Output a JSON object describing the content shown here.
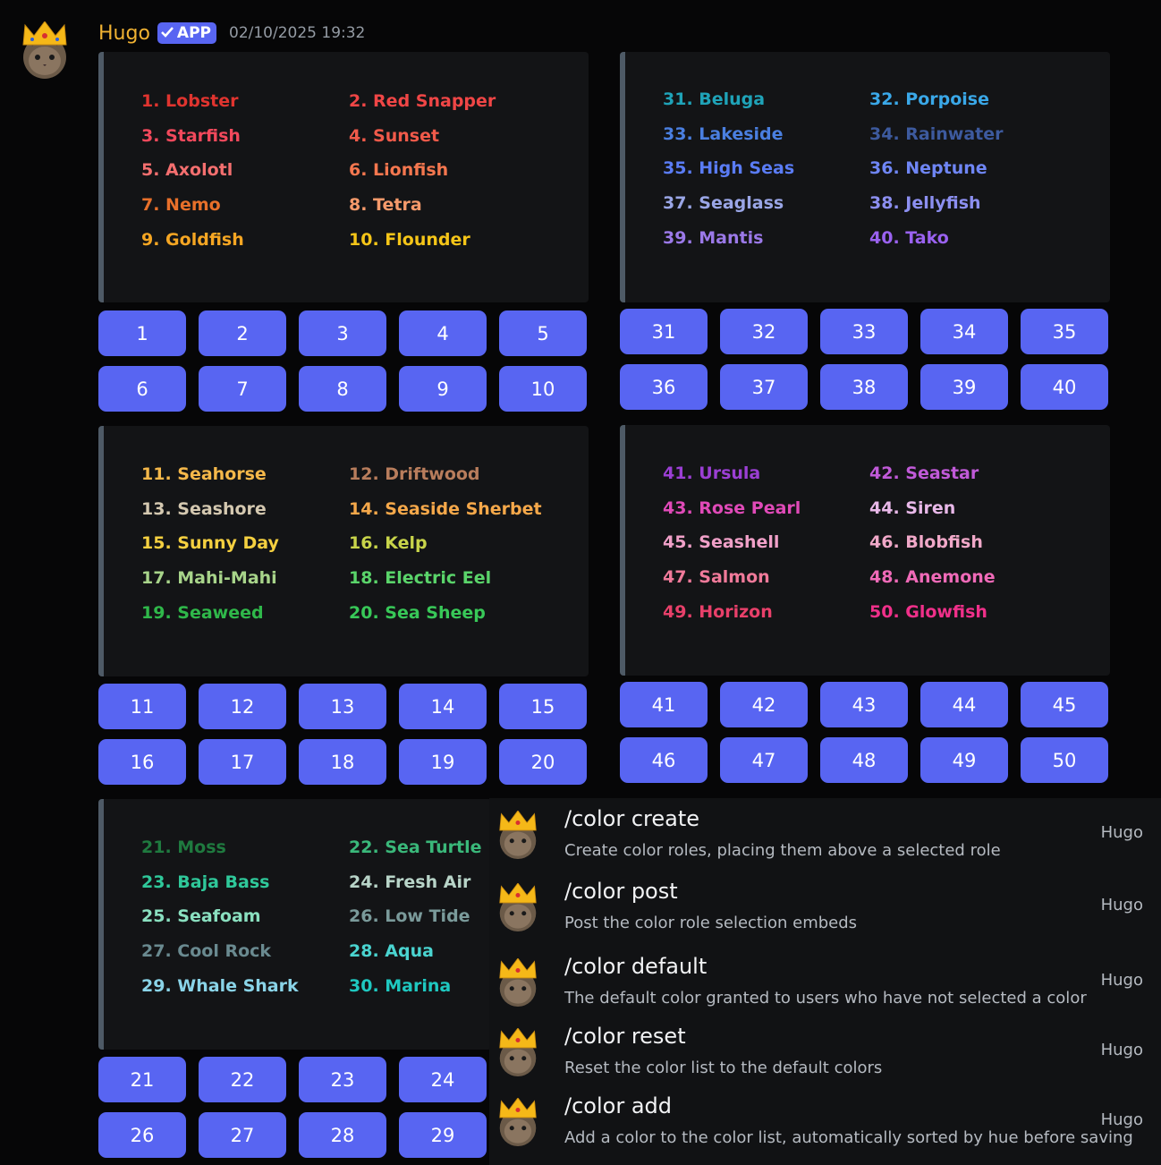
{
  "message": {
    "author": "Hugo",
    "badge": "APP",
    "timestamp": "02/10/2025 19:32"
  },
  "embeds": [
    {
      "items": [
        {
          "label": "1. Lobster",
          "color": "#e0342f"
        },
        {
          "label": "2. Red Snapper",
          "color": "#f04646"
        },
        {
          "label": "3. Starfish",
          "color": "#f2495c"
        },
        {
          "label": "4. Sunset",
          "color": "#f15a4a"
        },
        {
          "label": "5. Axolotl",
          "color": "#f46f6f"
        },
        {
          "label": "6. Lionfish",
          "color": "#f5774f"
        },
        {
          "label": "7. Nemo",
          "color": "#e8702a"
        },
        {
          "label": "8. Tetra",
          "color": "#f59a6b"
        },
        {
          "label": "9. Goldfish",
          "color": "#f5a623"
        },
        {
          "label": "10. Flounder",
          "color": "#f5c518"
        }
      ],
      "buttons": [
        "1",
        "2",
        "3",
        "4",
        "5",
        "6",
        "7",
        "8",
        "9",
        "10"
      ]
    },
    {
      "items": [
        {
          "label": "31. Beluga",
          "color": "#1fa3b8"
        },
        {
          "label": "32. Porpoise",
          "color": "#3aa8e8"
        },
        {
          "label": "33. Lakeside",
          "color": "#4a7fe0"
        },
        {
          "label": "34. Rainwater",
          "color": "#3d5a9e"
        },
        {
          "label": "35. High Seas",
          "color": "#5a7cf5"
        },
        {
          "label": "36. Neptune",
          "color": "#6f86f5"
        },
        {
          "label": "37. Seaglass",
          "color": "#9aa6e6"
        },
        {
          "label": "38. Jellyfish",
          "color": "#8c8ff0"
        },
        {
          "label": "39. Mantis",
          "color": "#9b79e8"
        },
        {
          "label": "40. Tako",
          "color": "#9a62f0"
        }
      ],
      "buttons": [
        "31",
        "32",
        "33",
        "34",
        "35",
        "36",
        "37",
        "38",
        "39",
        "40"
      ]
    },
    {
      "items": [
        {
          "label": "11. Seahorse",
          "color": "#f5b84a"
        },
        {
          "label": "12. Driftwood",
          "color": "#b87d5c"
        },
        {
          "label": "13. Seashore",
          "color": "#d4c8b0"
        },
        {
          "label": "14. Seaside Sherbet",
          "color": "#f5a84a"
        },
        {
          "label": "15. Sunny Day",
          "color": "#f5d040"
        },
        {
          "label": "16. Kelp",
          "color": "#c8d44a"
        },
        {
          "label": "17. Mahi-Mahi",
          "color": "#a8d48a"
        },
        {
          "label": "18. Electric Eel",
          "color": "#5ad46a"
        },
        {
          "label": "19. Seaweed",
          "color": "#2fb84a"
        },
        {
          "label": "20. Sea Sheep",
          "color": "#38c858"
        }
      ],
      "buttons": [
        "11",
        "12",
        "13",
        "14",
        "15",
        "16",
        "17",
        "18",
        "19",
        "20"
      ]
    },
    {
      "items": [
        {
          "label": "41. Ursula",
          "color": "#9b3fd4"
        },
        {
          "label": "42. Seastar",
          "color": "#c05ad8"
        },
        {
          "label": "43. Rose Pearl",
          "color": "#e04ab8"
        },
        {
          "label": "44. Siren",
          "color": "#e8b8e8"
        },
        {
          "label": "45. Seashell",
          "color": "#f0a0c8"
        },
        {
          "label": "46. Blobfish",
          "color": "#f0a8c8"
        },
        {
          "label": "47. Salmon",
          "color": "#f07a9a"
        },
        {
          "label": "48. Anemone",
          "color": "#f06ab8"
        },
        {
          "label": "49. Horizon",
          "color": "#e8406a"
        },
        {
          "label": "50. Glowfish",
          "color": "#f0308a"
        }
      ],
      "buttons": [
        "41",
        "42",
        "43",
        "44",
        "45",
        "46",
        "47",
        "48",
        "49",
        "50"
      ]
    },
    {
      "items": [
        {
          "label": "21. Moss",
          "color": "#1f7a3f"
        },
        {
          "label": "22. Sea Turtle",
          "color": "#3ab87a"
        },
        {
          "label": "23. Baja Bass",
          "color": "#2fc89a"
        },
        {
          "label": "24. Fresh Air",
          "color": "#b8d4c8"
        },
        {
          "label": "25. Seafoam",
          "color": "#8ae0c0"
        },
        {
          "label": "26. Low Tide",
          "color": "#7a9a9a"
        },
        {
          "label": "27. Cool Rock",
          "color": "#6a8a90"
        },
        {
          "label": "28. Aqua",
          "color": "#4ad4d0"
        },
        {
          "label": "29. Whale Shark",
          "color": "#8ad4e8"
        },
        {
          "label": "30. Marina",
          "color": "#1fc8c0"
        }
      ],
      "buttons": [
        "21",
        "22",
        "23",
        "24",
        "26",
        "27",
        "28",
        "29"
      ]
    }
  ],
  "commands": [
    {
      "name": "/color create",
      "description": "Create color roles, placing them above a selected role",
      "bot": "Hugo"
    },
    {
      "name": "/color post",
      "description": "Post the color role selection embeds",
      "bot": "Hugo"
    },
    {
      "name": "/color default",
      "description": "The default color granted to users who have not selected a color",
      "bot": "Hugo"
    },
    {
      "name": "/color reset",
      "description": "Reset the color list to the default colors",
      "bot": "Hugo"
    },
    {
      "name": "/color add",
      "description": "Add a color to the color list, automatically sorted by hue before saving",
      "bot": "Hugo"
    }
  ],
  "icons": {
    "avatar": "crowned-cat-avatar",
    "badge_check": "checkmark-icon"
  },
  "colors": {
    "blurple": "#5865f2",
    "author": "#f0b232",
    "embed_bg": "#131416",
    "page_bg": "#060607"
  }
}
